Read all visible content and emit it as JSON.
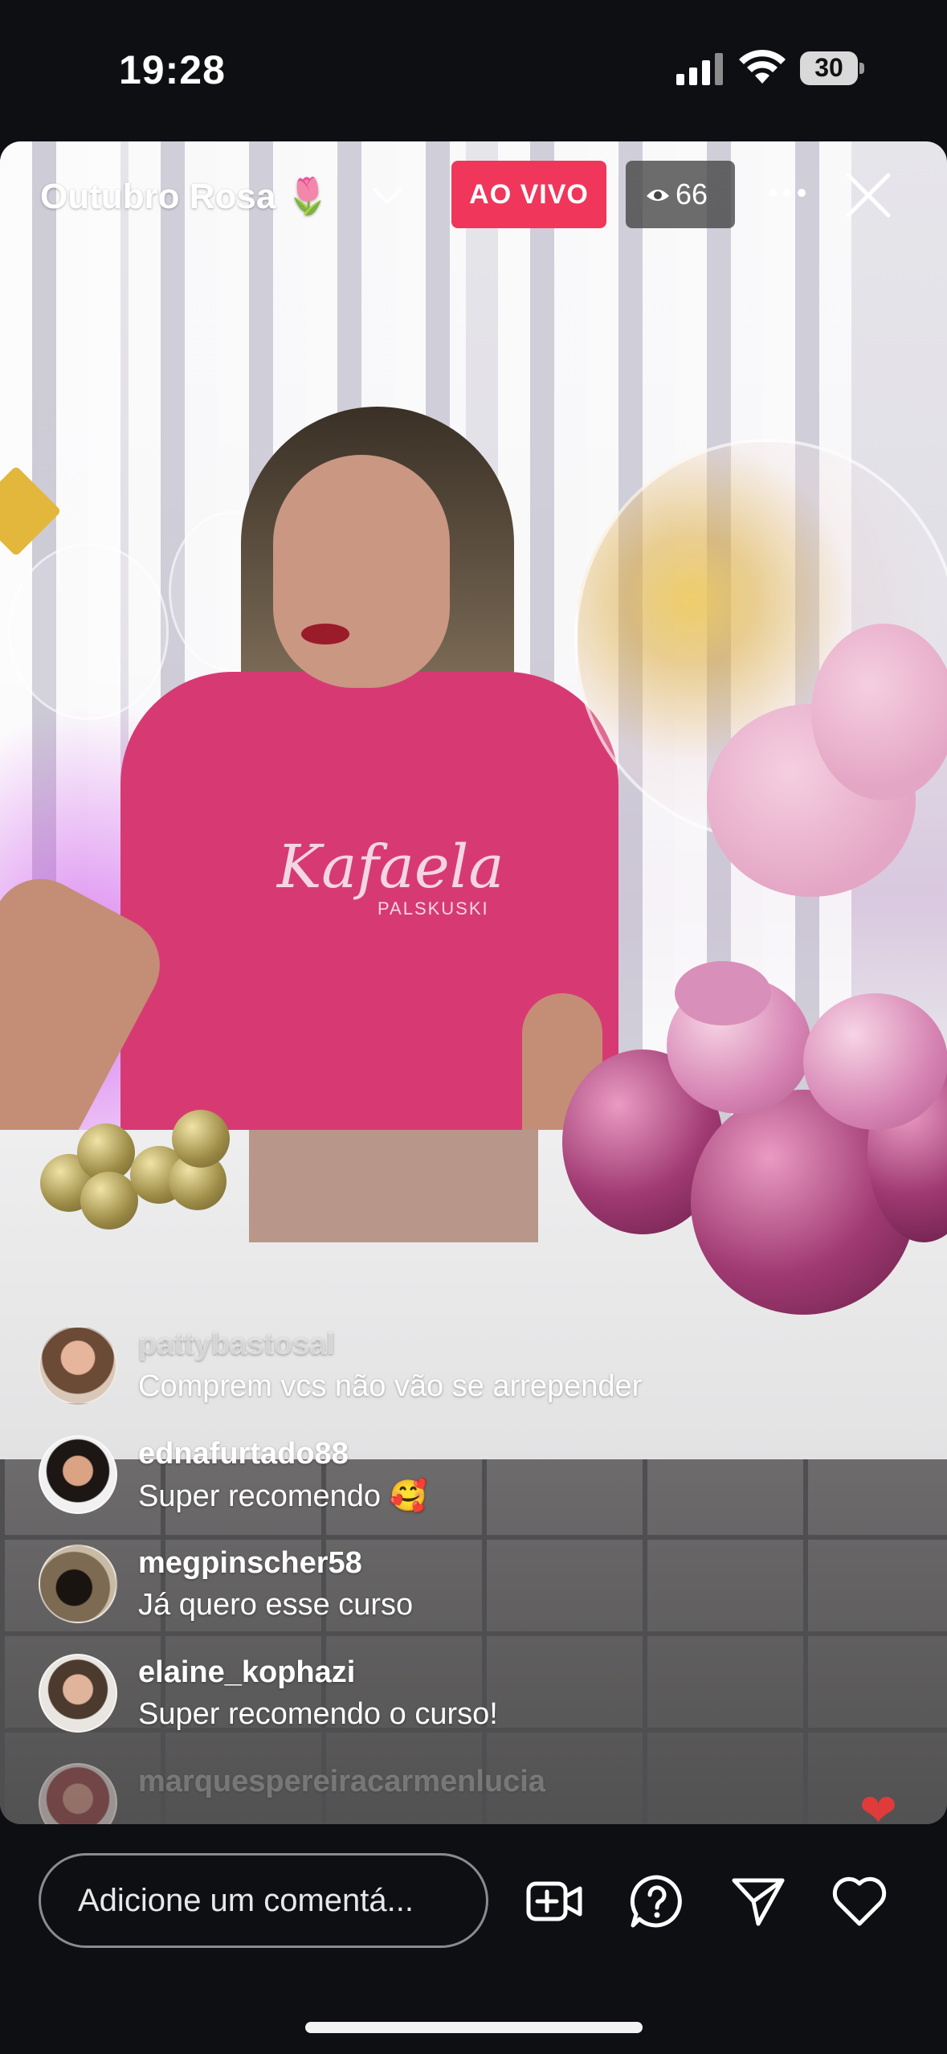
{
  "status_bar": {
    "time": "19:28",
    "battery": "30"
  },
  "live": {
    "title": "Outubro Rosa 🌷",
    "badge": "AO VIVO",
    "viewer_count": "66"
  },
  "shirt": {
    "brand": "Kafaela",
    "sub": "PALSKUSKI"
  },
  "comments": [
    {
      "username": "pattybastosal",
      "message": "Comprem vcs não vão se arrepender"
    },
    {
      "username": "ednafurtado88",
      "message": "Super recomendo 🥰"
    },
    {
      "username": "megpinscher58",
      "message": "Já quero esse curso"
    },
    {
      "username": "elaine_kophazi",
      "message": "Super recomendo o curso!"
    },
    {
      "username": "marquespereiracarmenlucia",
      "message": ""
    }
  ],
  "bottom_bar": {
    "comment_placeholder": "Adicione um comentá..."
  },
  "colors": {
    "live_badge": "#f0365b",
    "background": "#0e0f13"
  },
  "icons": [
    "signal-icon",
    "wifi-icon",
    "battery-icon",
    "chevron-down-icon",
    "eye-icon",
    "more-icon",
    "close-icon",
    "add-video-icon",
    "question-icon",
    "send-icon",
    "heart-icon"
  ]
}
